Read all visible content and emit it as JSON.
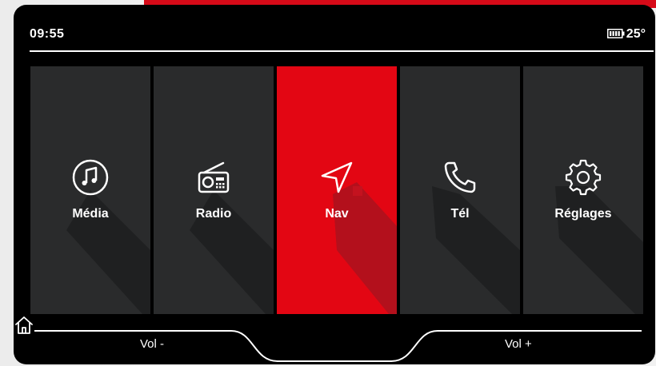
{
  "status": {
    "time": "09:55",
    "temperature": "25°",
    "battery_icon": "battery-icon"
  },
  "tiles": [
    {
      "label": "Média",
      "icon": "music-note-icon",
      "active": false
    },
    {
      "label": "Radio",
      "icon": "radio-icon",
      "active": false
    },
    {
      "label": "Nav",
      "icon": "navigation-arrow-icon",
      "active": true
    },
    {
      "label": "Tél",
      "icon": "phone-icon",
      "active": false
    },
    {
      "label": "Réglages",
      "icon": "gear-icon",
      "active": false
    }
  ],
  "bottom": {
    "vol_minus": "Vol -",
    "vol_plus": "Vol +",
    "home_icon": "home-icon"
  },
  "colors": {
    "accent": "#e30613",
    "tile": "#2a2b2c",
    "background": "#000000"
  }
}
